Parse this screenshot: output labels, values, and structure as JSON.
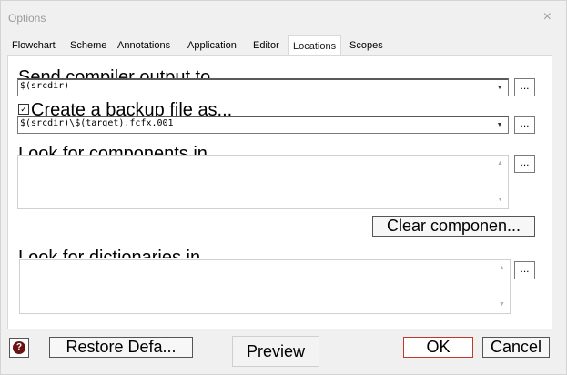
{
  "window": {
    "title": "Options",
    "close_glyph": "×"
  },
  "tabs": [
    {
      "label": "Flowchart",
      "active": false
    },
    {
      "label": "Scheme",
      "active": false
    },
    {
      "label": "Annotations",
      "active": false
    },
    {
      "label": "Application",
      "active": false
    },
    {
      "label": "Editor",
      "active": false
    },
    {
      "label": "Locations",
      "active": true
    },
    {
      "label": "Scopes",
      "active": false
    }
  ],
  "locations": {
    "compiler_output": {
      "label": "Send compiler output to",
      "value": "$(srcdir)"
    },
    "backup": {
      "label": "Create a backup file as...",
      "checked": true,
      "value": "$(srcdir)\\$(target).fcfx.001"
    },
    "components": {
      "label": "Look for components in",
      "clear_button": "Clear componen..."
    },
    "dictionaries": {
      "label": "Look for dictionaries in"
    },
    "browse_label": "..."
  },
  "footer": {
    "help_icon": "help-icon",
    "restore_label": "Restore Defa...",
    "preview_label": "Preview",
    "ok_label": "OK",
    "cancel_label": "Cancel"
  },
  "colors": {
    "accent_active_tab": "#1a1a1a",
    "ok_border": "#c0392b",
    "help_icon_fill": "#6b1212"
  }
}
